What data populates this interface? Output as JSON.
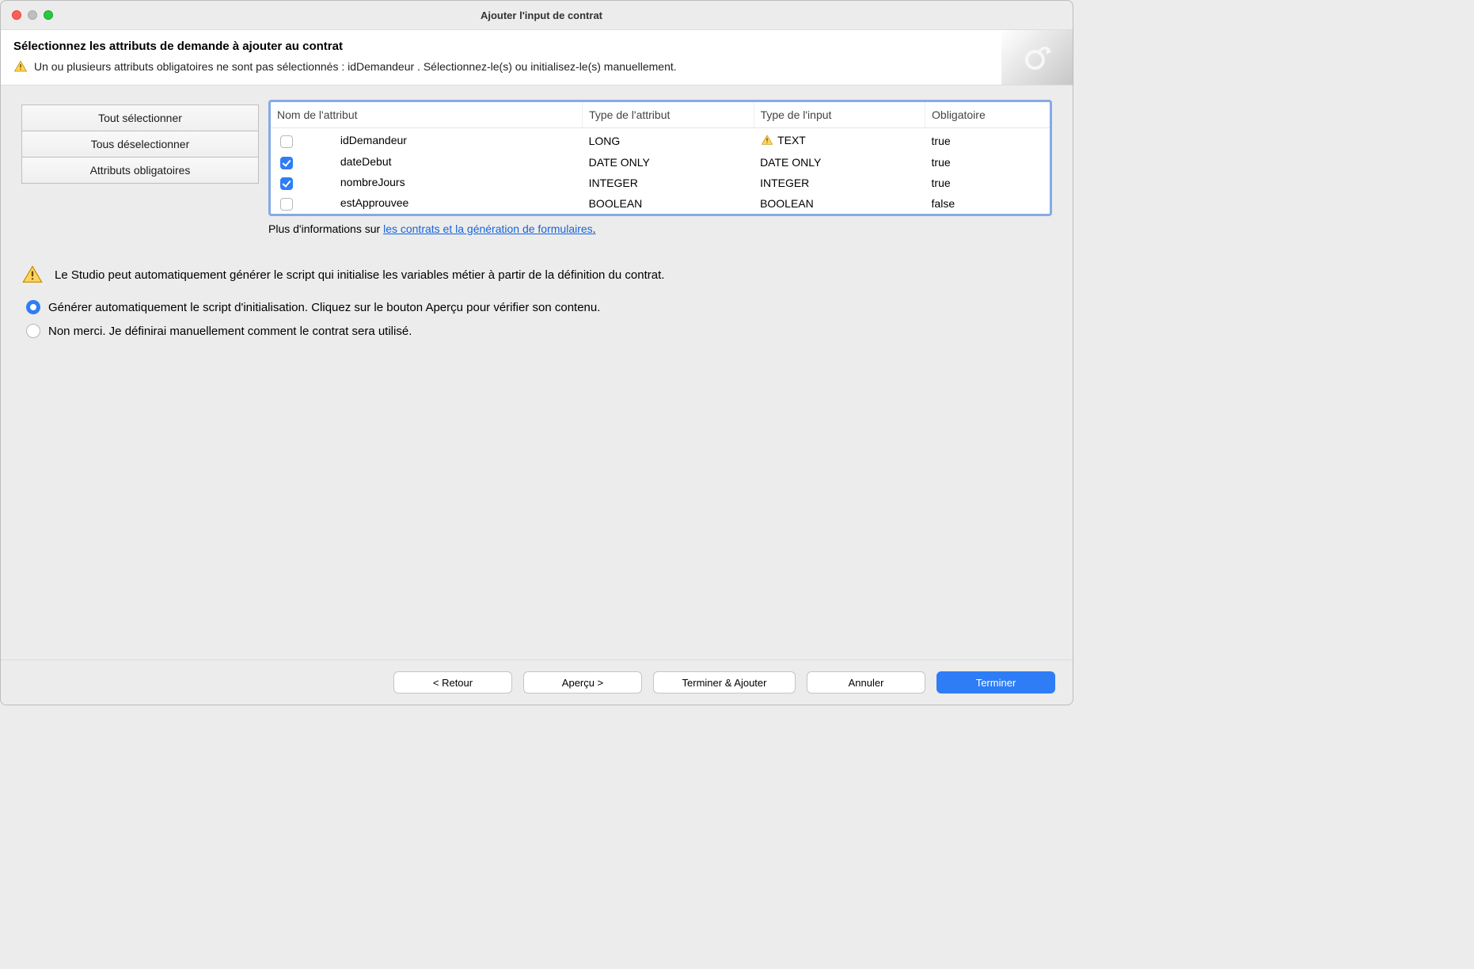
{
  "window": {
    "title": "Ajouter l'input de contrat"
  },
  "header": {
    "heading": "Sélectionnez les attributs de demande à ajouter au contrat",
    "warning": "Un ou plusieurs attributs obligatoires ne sont pas sélectionnés : idDemandeur . Sélectionnez-le(s) ou initialisez-le(s) manuellement."
  },
  "sidebar": {
    "select_all": "Tout sélectionner",
    "deselect_all": "Tous déselectionner",
    "mandatory": "Attributs obligatoires"
  },
  "table": {
    "columns": {
      "name": "Nom de l'attribut",
      "attr_type": "Type de l'attribut",
      "input_type": "Type de l'input",
      "mandatory": "Obligatoire"
    },
    "rows": [
      {
        "checked": false,
        "name": "idDemandeur",
        "attr_type": "LONG",
        "input_type": "TEXT",
        "input_warn": true,
        "mandatory": "true"
      },
      {
        "checked": true,
        "name": "dateDebut",
        "attr_type": "DATE ONLY",
        "input_type": "DATE ONLY",
        "input_warn": false,
        "mandatory": "true"
      },
      {
        "checked": true,
        "name": "nombreJours",
        "attr_type": "INTEGER",
        "input_type": "INTEGER",
        "input_warn": false,
        "mandatory": "true"
      },
      {
        "checked": false,
        "name": "estApprouvee",
        "attr_type": "BOOLEAN",
        "input_type": "BOOLEAN",
        "input_warn": false,
        "mandatory": "false"
      }
    ]
  },
  "more_info": {
    "prefix": "Plus d'informations sur ",
    "link": "les contrats et la génération de formulaires"
  },
  "script_section": {
    "message": "Le Studio peut automatiquement générer le script qui initialise les variables métier à partir de la définition du contrat.",
    "option_auto": "Générer automatiquement le script d'initialisation. Cliquez sur le bouton Aperçu pour vérifier son contenu.",
    "option_manual": "Non merci. Je définirai manuellement comment le contrat sera utilisé.",
    "selected": "auto"
  },
  "footer": {
    "back": "< Retour",
    "preview": "Aperçu >",
    "finish_add": "Terminer & Ajouter",
    "cancel": "Annuler",
    "finish": "Terminer"
  }
}
